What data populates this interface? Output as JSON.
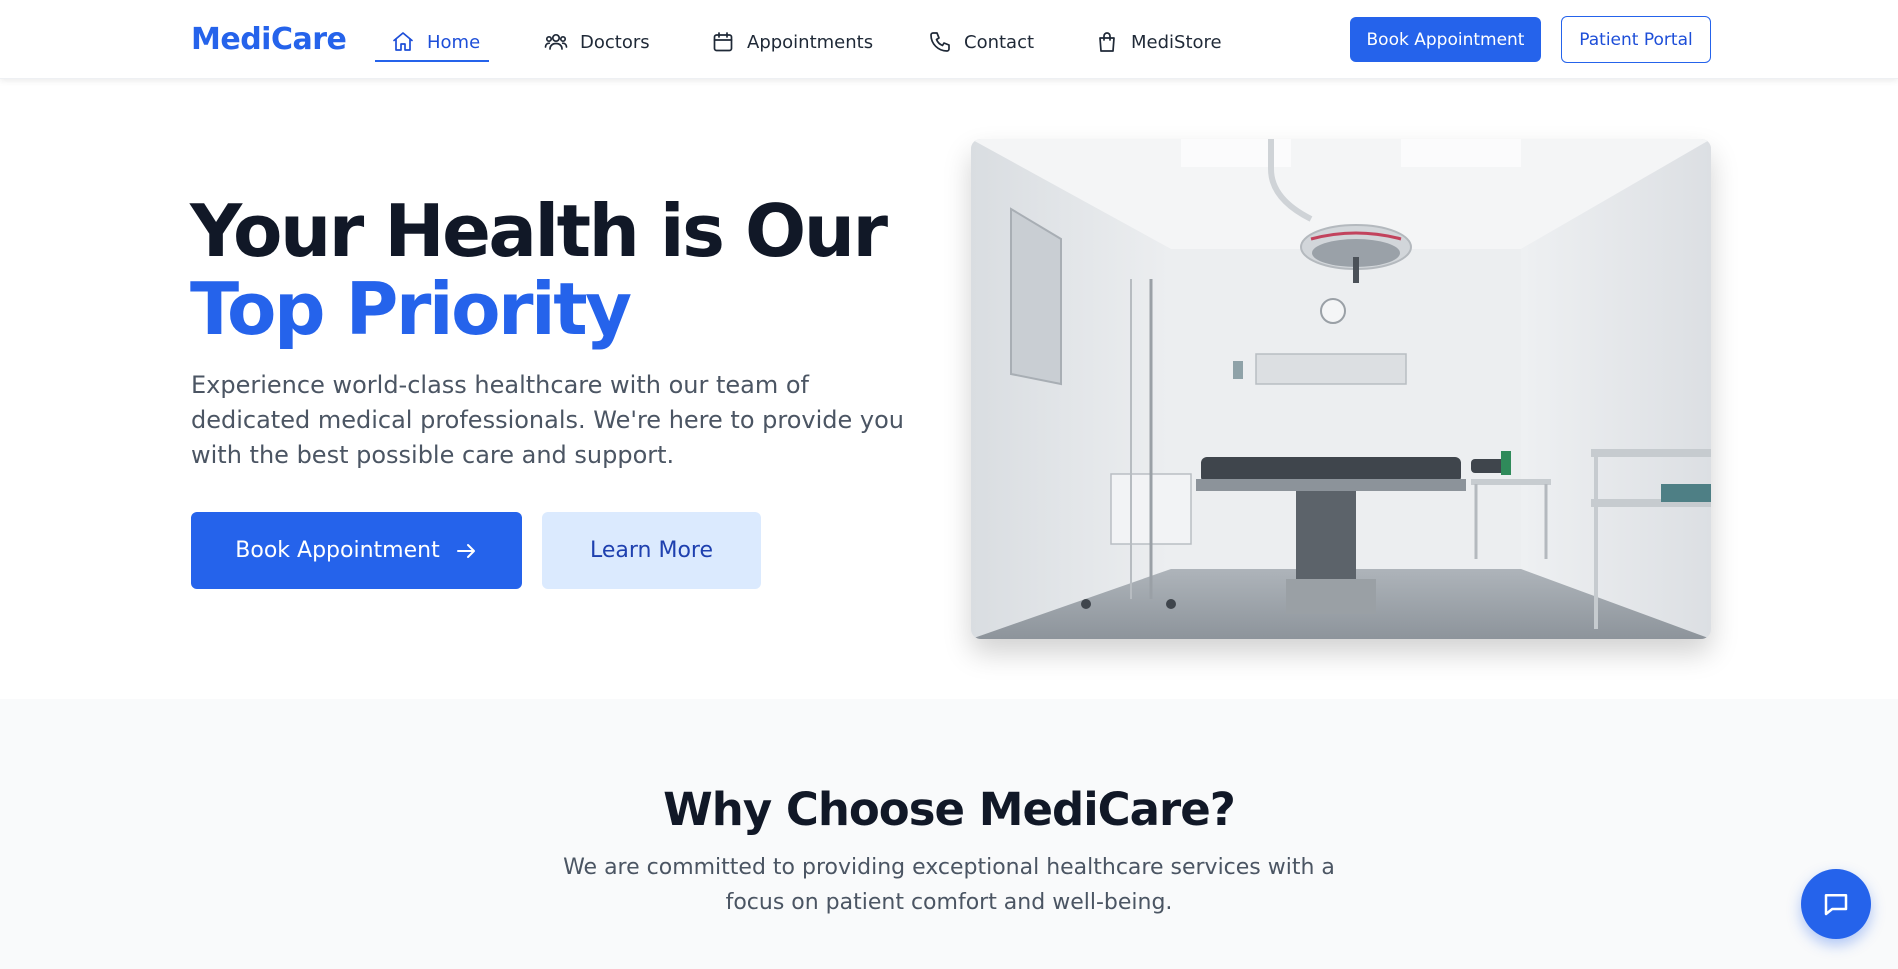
{
  "brand": {
    "name": "MediCare",
    "accent": "#2563eb"
  },
  "nav": {
    "items": [
      {
        "label": "Home",
        "icon": "home-icon",
        "active": true
      },
      {
        "label": "Doctors",
        "icon": "users-icon",
        "active": false
      },
      {
        "label": "Appointments",
        "icon": "calendar-icon",
        "active": false
      },
      {
        "label": "Contact",
        "icon": "phone-icon",
        "active": false
      },
      {
        "label": "MediStore",
        "icon": "shopping-bag-icon",
        "active": false
      }
    ],
    "book_label": "Book Appointment",
    "portal_label": "Patient Portal"
  },
  "hero": {
    "title_line1": "Your Health is Our",
    "title_line2": "Top Priority",
    "description": "Experience world-class healthcare with our team of dedicated medical professionals. We're here to provide you with the best possible care and support.",
    "primary_cta": "Book Appointment",
    "secondary_cta": "Learn More",
    "image_icon": "operating-room-photo"
  },
  "why": {
    "title": "Why Choose MediCare?",
    "description": "We are committed to providing exceptional healthcare services with a focus on patient comfort and well-being."
  },
  "chat": {
    "icon": "chat-icon"
  }
}
